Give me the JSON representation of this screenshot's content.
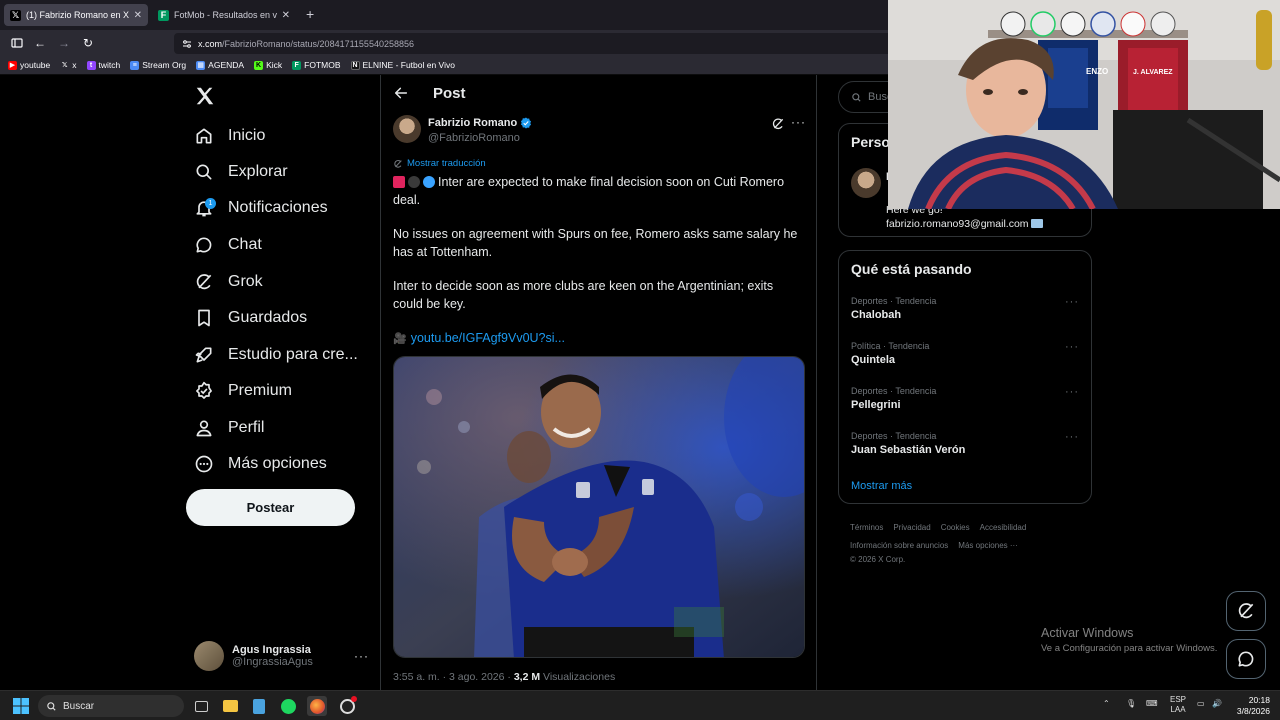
{
  "browser": {
    "tabs": [
      {
        "title": "(1) Fabrizio Romano en X: \"",
        "active": true
      },
      {
        "title": "FotMob - Resultados en vivo de",
        "active": false
      }
    ],
    "url_host": "x.com",
    "url_path": "/FabrizioRomano/status/2084171155540258856",
    "bookmarks": [
      "youtube",
      "x",
      "twitch",
      "Stream Org",
      "AGENDA",
      "Kick",
      "FOTMOB",
      "ELNINE - Futbol en Vivo"
    ]
  },
  "nav": {
    "items": [
      {
        "label": "Inicio",
        "icon": "home-icon"
      },
      {
        "label": "Explorar",
        "icon": "search-icon"
      },
      {
        "label": "Notificaciones",
        "icon": "bell-icon",
        "badge": "1"
      },
      {
        "label": "Chat",
        "icon": "chat-icon"
      },
      {
        "label": "Grok",
        "icon": "grok-icon"
      },
      {
        "label": "Guardados",
        "icon": "bookmark-icon"
      },
      {
        "label": "Estudio para cre...",
        "icon": "rocket-icon"
      },
      {
        "label": "Premium",
        "icon": "premium-icon"
      },
      {
        "label": "Perfil",
        "icon": "person-icon"
      },
      {
        "label": "Más opciones",
        "icon": "more-circle-icon"
      }
    ],
    "post_button": "Postear",
    "account": {
      "display_name": "Agus Ingrassia",
      "handle": "@IngrassiaAgus"
    }
  },
  "post": {
    "header_title": "Post",
    "author": {
      "display_name": "Fabrizio Romano",
      "handle": "@FabrizioRomano"
    },
    "translate_label": "Mostrar traducción",
    "paragraphs": [
      "Inter are expected to make final decision soon on Cuti Romero deal.",
      "No issues on agreement with Spurs on fee, Romero asks same salary he has at Tottenham.",
      "Inter to decide soon as more clubs are keen on the Argentinian; exits could be key."
    ],
    "link": "youtu.be/IGFAgf9Vv0U?si...",
    "time": "3:55 a. m. · 3 ago. 2026 · ",
    "views_count": "3,2 M",
    "views_label": " Visualizaciones"
  },
  "sidebar": {
    "search_placeholder": "Buscar",
    "profile_card_title": "Perso",
    "profile_card_initial": "F",
    "profile_card_line1": "Here we go! ",
    "profile_card_email": "fabrizio.romano93@gmail.com",
    "trends_title": "Qué está pasando",
    "trends": [
      {
        "category": "Deportes · Tendencia",
        "name": "Chalobah"
      },
      {
        "category": "Política · Tendencia",
        "name": "Quintela"
      },
      {
        "category": "Deportes · Tendencia",
        "name": "Pellegrini"
      },
      {
        "category": "Deportes · Tendencia",
        "name": "Juan Sebastián Verón"
      }
    ],
    "show_more": "Mostrar más",
    "footer": [
      "Términos",
      "Privacidad",
      "Cookies",
      "Accesibilidad",
      "Información sobre anuncios",
      "Más opciones ···",
      "© 2026 X Corp."
    ]
  },
  "watermark": {
    "line1": "Activar Windows",
    "line2": "Ve a Configuración para activar Windows."
  },
  "webcam": {
    "jersey_name_1": "ENZO",
    "jersey_name_2": "J. ALVAREZ"
  },
  "taskbar": {
    "search_label": "Buscar",
    "lang_top": "ESP",
    "lang_bottom": "LAA",
    "time": "20:18",
    "date": "3/8/2026"
  },
  "colors": {
    "accent": "#1d9bf0",
    "background": "#000000",
    "border": "#2f3336"
  }
}
